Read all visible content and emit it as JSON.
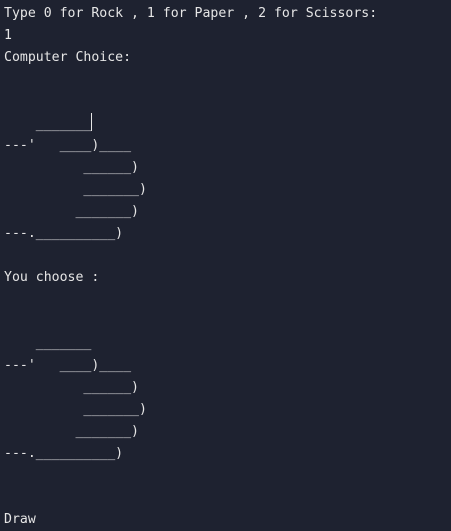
{
  "terminal": {
    "prompt": "Type 0 for Rock , 1 for Paper , 2 for Scissors:",
    "user_input": "1",
    "computer_heading": "Computer Choice:",
    "computer_art": [
      "",
      "",
      "    _______",
      "---'   ____)____",
      "          ______)",
      "          _______)",
      "         _______)",
      "---.__________)"
    ],
    "user_heading": "You choose :",
    "user_art": [
      "",
      "",
      "    _______",
      "---'   ____)____",
      "          ______)",
      "          _______)",
      "         _______)",
      "---.__________)"
    ],
    "result": "Draw"
  },
  "colors": {
    "background": "#1e2230",
    "text": "#e6e6e6"
  }
}
